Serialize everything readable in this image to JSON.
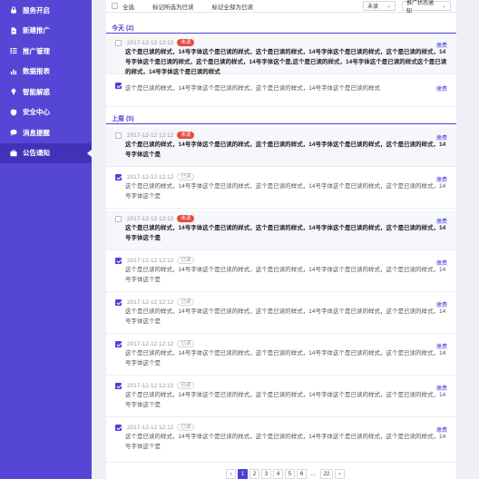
{
  "sidebar": {
    "items": [
      {
        "label": "服务开启",
        "icon": "lock-icon"
      },
      {
        "label": "新建推广",
        "icon": "document-icon"
      },
      {
        "label": "推广管理",
        "icon": "list-icon"
      },
      {
        "label": "数据报表",
        "icon": "chart-icon"
      },
      {
        "label": "智能解惑",
        "icon": "bulb-icon"
      },
      {
        "label": "安全中心",
        "icon": "shield-icon"
      },
      {
        "label": "消息提醒",
        "icon": "message-icon"
      },
      {
        "label": "公告通知",
        "icon": "briefcase-icon",
        "active": true
      }
    ]
  },
  "toolbar": {
    "select_all": "全选",
    "mark_selected": "标记所选为已读",
    "mark_all": "标记全部为已读",
    "status_filter": "未读",
    "type_filter": "推广状态通知"
  },
  "sections": {
    "today": "今天 (2)",
    "last_week": "上周 (5)"
  },
  "notices": [
    {
      "checked": false,
      "unread": true,
      "time": "2017-12-12  12:12",
      "status": "未读",
      "category": "缴费",
      "body": "这个是已读的样式，14号字体这个是已读的样式，这个是已读的样式，14号字体这个是已读的样式，这个是已读的样式，14号字体这个是已读的样式，这个是已读的样式，14号字体这个是,这个是已读的样式，14号字体这个是已读的样式这个是已读的样式，14号字体这个是已读的样式"
    },
    {
      "checked": true,
      "unread": false,
      "time": "",
      "status": "",
      "category": "缴费",
      "body": "这个是已读的样式，14号字体这个是已读的样式，这个是已读的样式，14号字体这个是已读的样式"
    },
    {
      "checked": false,
      "unread": true,
      "time": "2017-12-12  12:12",
      "status": "未读",
      "category": "缴费",
      "body": "这个是已读的样式，14号字体这个是已读的样式，这个是已读的样式，14号字体这个是已读的样式，这个是已读的样式，14号字体这个是"
    },
    {
      "checked": true,
      "unread": false,
      "time": "2017-12-12  12:12",
      "status": "已读",
      "category": "缴费",
      "body": "这个是已读的样式，14号字体这个是已读的样式，这个是已读的样式，14号字体这个是已读的样式，这个是已读的样式，14号字体这个是"
    },
    {
      "checked": false,
      "unread": true,
      "time": "2017-12-12  12:12",
      "status": "未读",
      "category": "缴费",
      "body": "这个是已读的样式，14号字体这个是已读的样式，这个是已读的样式，14号字体这个是已读的样式，这个是已读的样式，14号字体这个是"
    },
    {
      "checked": true,
      "unread": false,
      "time": "2017-12-12  12:12",
      "status": "已读",
      "category": "缴费",
      "body": "这个是已读的样式，14号字体这个是已读的样式，这个是已读的样式，14号字体这个是已读的样式，这个是已读的样式，14号字体这个是"
    },
    {
      "checked": true,
      "unread": false,
      "time": "2017-12-12  12:12",
      "status": "已读",
      "category": "缴费",
      "body": "这个是已读的样式，14号字体这个是已读的样式，这个是已读的样式，14号字体这个是已读的样式，这个是已读的样式，14号字体这个是"
    },
    {
      "checked": true,
      "unread": false,
      "time": "2017-12-12  12:12",
      "status": "已读",
      "category": "缴费",
      "body": "这个是已读的样式，14号字体这个是已读的样式，这个是已读的样式，14号字体这个是已读的样式，这个是已读的样式，14号字体这个是"
    },
    {
      "checked": true,
      "unread": false,
      "time": "2017-12-12  12:12",
      "status": "已读",
      "category": "缴费",
      "body": "这个是已读的样式，14号字体这个是已读的样式，这个是已读的样式，14号字体这个是已读的样式，这个是已读的样式，14号字体这个是"
    },
    {
      "checked": true,
      "unread": false,
      "time": "2017-12-12  12:12",
      "status": "已读",
      "category": "缴费",
      "body": "这个是已读的样式，14号字体这个是已读的样式，这个是已读的样式，14号字体这个是已读的样式，这个是已读的样式，14号字体这个是"
    }
  ],
  "pagination": {
    "prev": "‹",
    "pages": [
      "1",
      "2",
      "3",
      "4",
      "5",
      "6",
      "…",
      "22"
    ],
    "current": "1",
    "next": "›"
  },
  "colors": {
    "sidebar_bg": "#5546d6",
    "sidebar_active": "#4132b8",
    "accent": "#4c3fd6",
    "unread_badge": "#e94b3c"
  }
}
